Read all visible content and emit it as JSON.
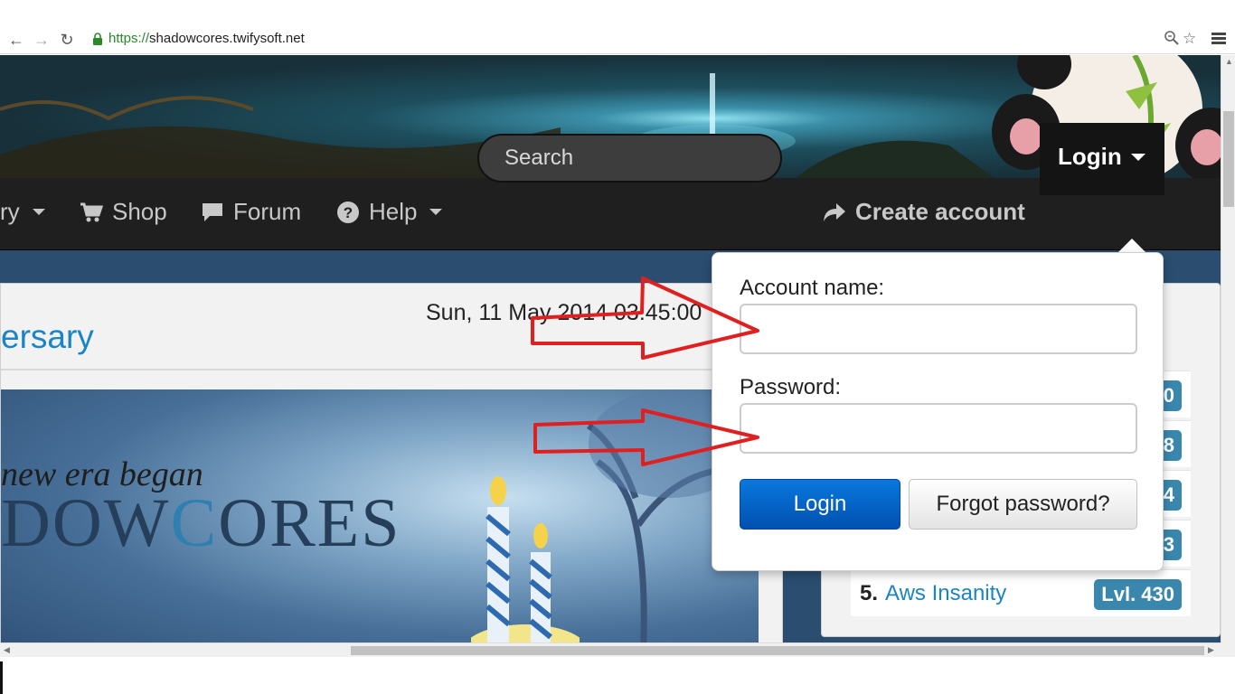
{
  "browser": {
    "url_scheme": "https://",
    "url_host": "shadowcores.twifysoft.net",
    "icons": [
      "back-arrow-icon",
      "forward-arrow-icon",
      "reload-icon",
      "lock-icon",
      "zoom-icon",
      "star-icon",
      "menu-icon"
    ]
  },
  "navbar": {
    "items": [
      {
        "label": "ry",
        "icon": "none",
        "has_caret": true
      },
      {
        "label": "Shop",
        "icon": "cart-icon",
        "has_caret": false
      },
      {
        "label": "Forum",
        "icon": "speech-bubble-icon",
        "has_caret": false
      },
      {
        "label": "Help",
        "icon": "question-circle-icon",
        "has_caret": true
      }
    ],
    "search_placeholder": "Search",
    "create_account": "Create account",
    "login": "Login"
  },
  "main": {
    "date": "Sun, 11 May 2014 03:45:00",
    "title": "ersary",
    "banner_line1": "new era began",
    "banner_line2": "DOWCORES",
    "banner_line2_lead": "DOW",
    "banner_line2_accent": "C",
    "banner_line2_tail": "ORES"
  },
  "ranking": {
    "rows": [
      {
        "num": "",
        "name": "",
        "level": "0"
      },
      {
        "num": "",
        "name": "",
        "level": "8"
      },
      {
        "num": "",
        "name": "",
        "level": "4"
      },
      {
        "num": "",
        "name": "",
        "level": "3"
      },
      {
        "num": "5.",
        "name": "Aws Insanity",
        "level": "Lvl. 430"
      }
    ]
  },
  "login_popover": {
    "account_label": "Account name:",
    "account_value": "",
    "password_label": "Password:",
    "password_value": "",
    "login_button": "Login",
    "forgot_button": "Forgot password?"
  },
  "colors": {
    "link": "#1a84c6",
    "badge": "#3a87ad",
    "login_button": "#0a6ad0",
    "annotation_arrow": "#e02020",
    "navbar": "#1f1f1f"
  }
}
